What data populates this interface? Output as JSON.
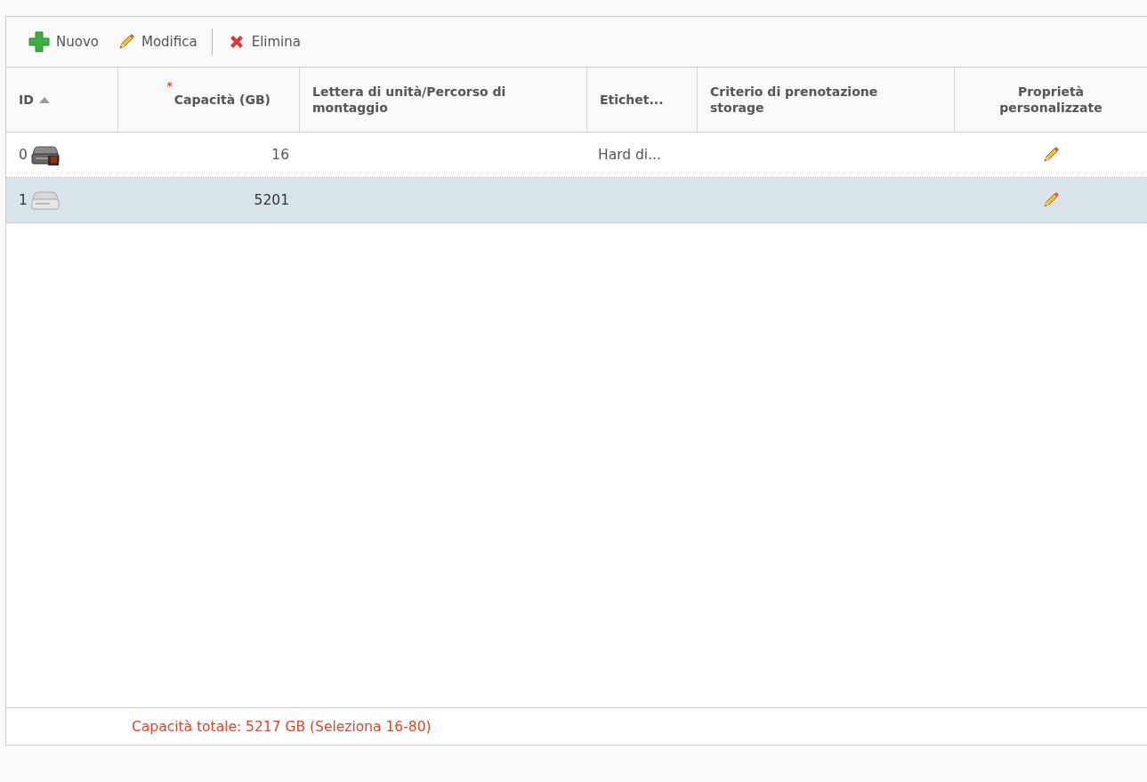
{
  "toolbar": [
    {
      "kind": "add",
      "label": "Nuovo",
      "disabled": false
    },
    {
      "kind": "edit",
      "label": "Modifica",
      "disabled": false
    },
    {
      "kind": "separator"
    },
    {
      "kind": "delete",
      "label": "Elimina",
      "disabled": false
    }
  ],
  "table": {
    "columns": [
      {
        "label": "ID",
        "sorted": true
      },
      {
        "label": "Capacità (GB)",
        "required_mark": "*",
        "sorted": false
      },
      {
        "label": "Lettera di unità/Percorso di montaggio",
        "sorted": false
      },
      {
        "label": "Etichet...",
        "sorted": false
      },
      {
        "label": "Criterio di prenotazione storage",
        "sorted": false
      },
      {
        "label": "Proprietà personalizzate",
        "sorted": false
      }
    ],
    "rows": [
      {
        "id": "0",
        "badged": true,
        "capacity": "16",
        "label": "Hard di...",
        "selected": false
      },
      {
        "id": "1",
        "badged": false,
        "capacity": "5201",
        "selected": true
      }
    ]
  },
  "footer": {
    "message": "Capacità totale: 5217 GB (Seleziona 16-80)"
  }
}
